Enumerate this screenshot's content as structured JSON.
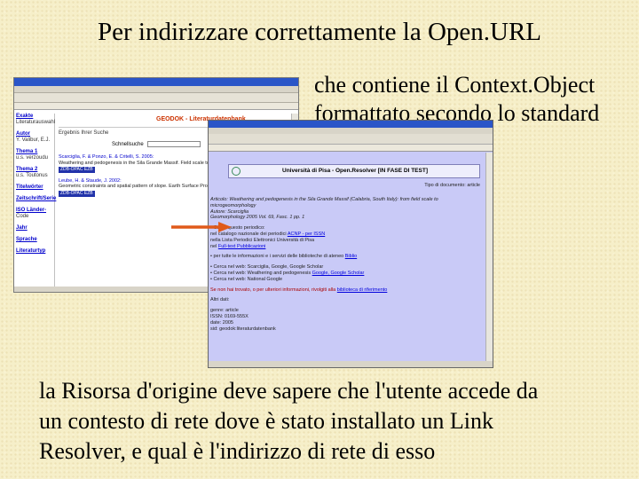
{
  "slide": {
    "title": "Per indirizzare correttamente la Open.URL",
    "right_lines": [
      "che contiene il Context.Object",
      "formattato secondo lo standard"
    ],
    "bottom_lines": [
      "la Risorsa d'origine deve sapere che l'utente accede da",
      "un contesto di rete dove è stato installato un Link",
      "Resolver, e qual è l'indirizzo di rete di esso"
    ]
  },
  "geodok": {
    "brand": "GEODOK - Literaturdatenbank",
    "heading": "Ergebnis Ihrer Suche",
    "search_label": "Schnellsuche",
    "sidebar": [
      {
        "head": "Exakte",
        "sub": "Literaturauswahl"
      },
      {
        "head": "Autor",
        "sub": "Y. Valibur, E.J."
      },
      {
        "head": "Thema 1",
        "sub": "u.s. verzoudu"
      },
      {
        "head": "Thema 2",
        "sub": "u.s. Toutonus"
      },
      {
        "head": "Titelwörter",
        "sub": ""
      },
      {
        "head": "Zeitschrift/Serie",
        "sub": ""
      },
      {
        "head": "ISO Länder-",
        "sub": "Code"
      },
      {
        "head": "Jahr",
        "sub": ""
      },
      {
        "head": "Sprache",
        "sub": ""
      },
      {
        "head": "Literaturtyp",
        "sub": ""
      }
    ],
    "results": [
      {
        "title": "Scarciglia, F. & Ponzo, E. & Critelli, S. 2005:",
        "text": "Weathering and pedogenesis in the Sila Grande Massif. Field scale to microgeomorphology.",
        "tag": "ZDB-OPAC EZB"
      },
      {
        "title": "Leube, H. & Staude, J. 2002:",
        "text": "Geometric constraints and spatial pattern of slope. Earth Surface Processes and Landforms.",
        "tag": "ZDB-OPAC EZB"
      }
    ]
  },
  "resolver": {
    "banner": "Università di Pisa - Open.Resolver [IN FASE DI TEST]",
    "doctype": "Tipo di documento: article",
    "rows": [
      {
        "text": "Articolo: Weathering and pedogenesis in the Sila Grande Massif (Calabria, South Italy): from field scale to",
        "style": "it",
        "link": ""
      },
      {
        "text": "microgeomorphology",
        "style": "it",
        "link": ""
      },
      {
        "text": "Autore: Scarciglia",
        "style": "it",
        "link": ""
      },
      {
        "text": "Geomorphology 2005 Vol. 69, Fasc. 1 pp. 1",
        "style": "it",
        "link": ""
      },
      {
        "text": "",
        "style": "gap",
        "link": ""
      },
      {
        "text": "• Cerca questo periodico:",
        "style": "",
        "link": ""
      },
      {
        "text": "   nel catalogo nazionale dei periodici",
        "style": "",
        "link": "ACNP - per ISSN"
      },
      {
        "text": "   nella Lista Periodici Elettronici Università di Pisa",
        "style": "",
        "link": ""
      },
      {
        "text": "   nel",
        "style": "",
        "link": "Full-text Pubblicazioni"
      },
      {
        "text": "",
        "style": "gap",
        "link": ""
      },
      {
        "text": "• per tutte le informazioni e i servizi delle biblioteche di ateneo",
        "style": "",
        "link": "Biblio"
      },
      {
        "text": "",
        "style": "gap",
        "link": ""
      },
      {
        "text": "• Cerca nel web: Scarciglia, Google, Google Scholar",
        "style": "",
        "link": ""
      },
      {
        "text": "• Cerca nel web: Weathering and pedogenesis",
        "style": "",
        "link": "Google, Google Scholar"
      },
      {
        "text": "• Cerca nel web: National Google",
        "style": "",
        "link": ""
      },
      {
        "text": "",
        "style": "gap",
        "link": ""
      },
      {
        "text": "Se non hai trovato, o per ulteriori informazioni, rivolgiti alla",
        "style": "red",
        "link": "biblioteca di riferimento"
      },
      {
        "text": "",
        "style": "gap",
        "link": ""
      },
      {
        "text": "Altri dati:",
        "style": "",
        "link": ""
      },
      {
        "text": "",
        "style": "gap",
        "link": ""
      },
      {
        "text": "    genre: article",
        "style": "",
        "link": ""
      },
      {
        "text": "    ISSN: 0169-555X",
        "style": "",
        "link": ""
      },
      {
        "text": "    date: 2005",
        "style": "",
        "link": ""
      },
      {
        "text": "    sid: geodok:literaturdatenbank",
        "style": "",
        "link": ""
      }
    ]
  },
  "colors": {
    "background": "#f6efc9",
    "arrow": "#e05a1a",
    "resolver_bg": "#c9caf7",
    "window_titlebar": "#2a55c8"
  }
}
